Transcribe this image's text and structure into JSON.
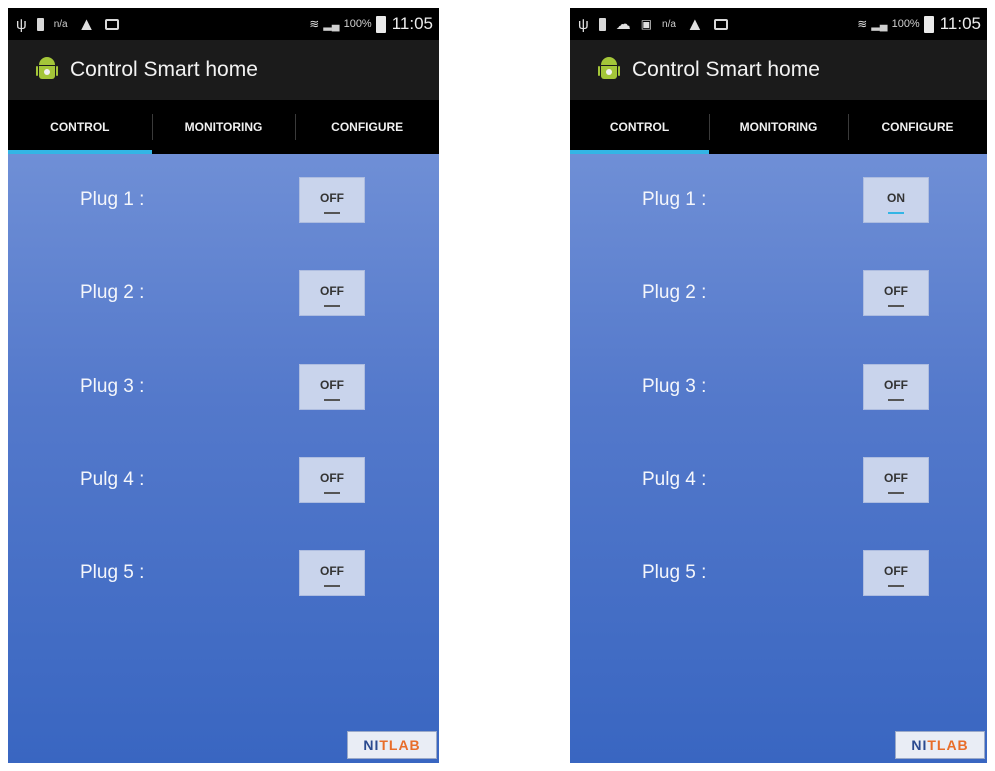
{
  "screens": [
    {
      "status": {
        "na": "n/a",
        "battery_pct": "100%",
        "time": "11:05"
      },
      "app_title": "Control Smart home",
      "tabs": [
        {
          "label": "CONTROL",
          "active": true
        },
        {
          "label": "MONITORING",
          "active": false
        },
        {
          "label": "CONFIGURE",
          "active": false
        }
      ],
      "plugs": [
        {
          "label": "Plug 1 :",
          "state": "OFF"
        },
        {
          "label": "Plug 2 :",
          "state": "OFF"
        },
        {
          "label": "Plug 3 :",
          "state": "OFF"
        },
        {
          "label": "Pulg 4 :",
          "state": "OFF"
        },
        {
          "label": "Plug 5 :",
          "state": "OFF"
        }
      ],
      "logo": {
        "part1": "NI",
        "part2": "T",
        "part3": "LAB"
      }
    },
    {
      "status": {
        "na": "n/a",
        "battery_pct": "100%",
        "time": "11:05"
      },
      "app_title": "Control Smart home",
      "tabs": [
        {
          "label": "CONTROL",
          "active": true
        },
        {
          "label": "MONITORING",
          "active": false
        },
        {
          "label": "CONFIGURE",
          "active": false
        }
      ],
      "plugs": [
        {
          "label": "Plug 1 :",
          "state": "ON"
        },
        {
          "label": "Plug 2 :",
          "state": "OFF"
        },
        {
          "label": "Plug 3 :",
          "state": "OFF"
        },
        {
          "label": "Pulg 4 :",
          "state": "OFF"
        },
        {
          "label": "Plug 5 :",
          "state": "OFF"
        }
      ],
      "logo": {
        "part1": "NI",
        "part2": "T",
        "part3": "LAB"
      }
    }
  ],
  "colors": {
    "tab_indicator": "#33b5e5",
    "content_gradient_top": "#6f8fd6",
    "content_gradient_bottom": "#3966c1",
    "android_green": "#a4c639"
  }
}
